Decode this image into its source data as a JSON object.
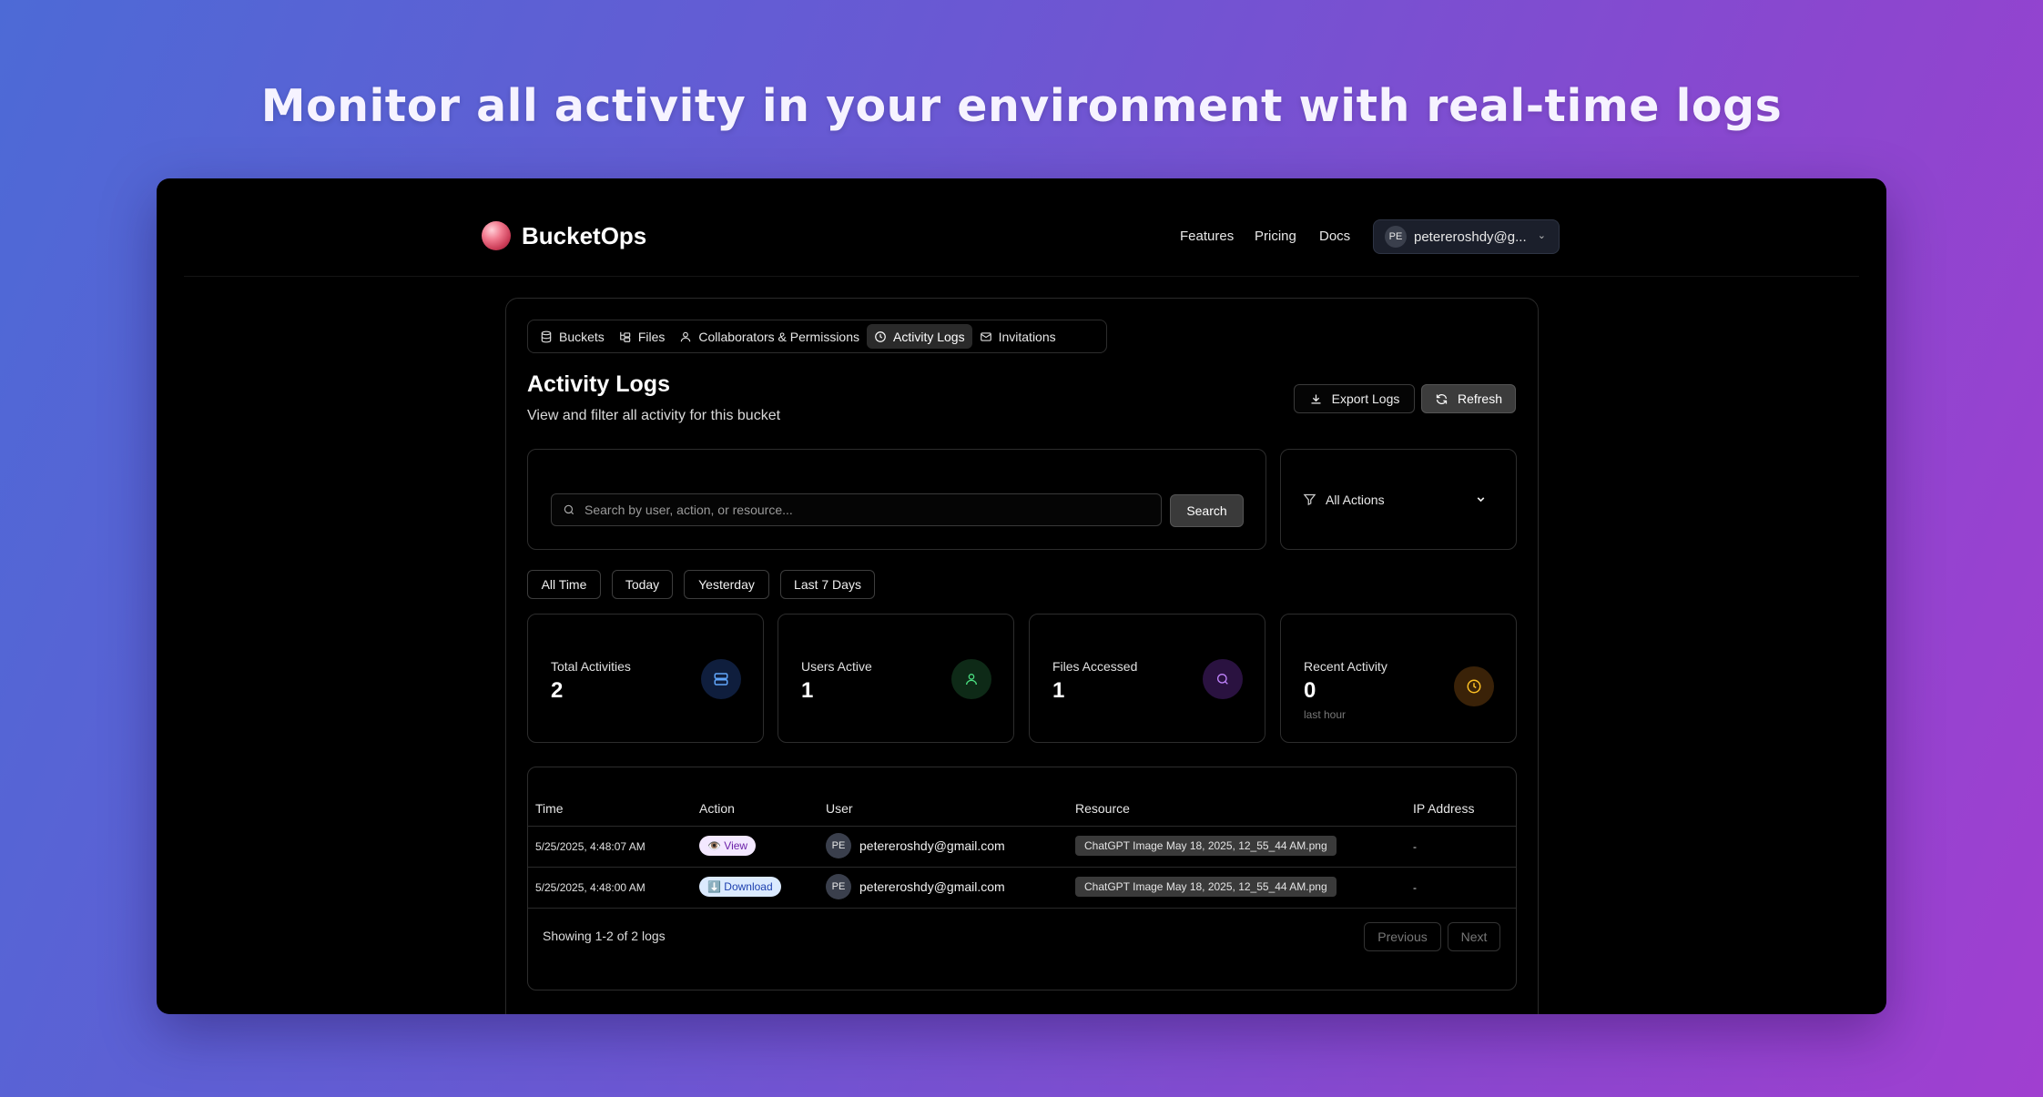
{
  "headline": "Monitor all activity in your environment with real-time logs",
  "nav": {
    "brand": "BucketOps",
    "links": [
      "Features",
      "Pricing",
      "Docs"
    ],
    "user_initials": "PE",
    "user_email": "petereroshdy@g..."
  },
  "tabs": [
    {
      "label": "Buckets",
      "icon": "database-icon"
    },
    {
      "label": "Files",
      "icon": "folder-tree-icon"
    },
    {
      "label": "Collaborators & Permissions",
      "icon": "user-icon"
    },
    {
      "label": "Activity Logs",
      "icon": "clock-icon",
      "active": true
    },
    {
      "label": "Invitations",
      "icon": "mail-icon"
    }
  ],
  "page": {
    "title": "Activity Logs",
    "subtitle": "View and filter all activity for this bucket",
    "export_label": "Export Logs",
    "refresh_label": "Refresh"
  },
  "search": {
    "placeholder": "Search by user, action, or resource...",
    "button": "Search"
  },
  "filter": {
    "selected": "All Actions"
  },
  "date_filters": [
    "All Time",
    "Today",
    "Yesterday",
    "Last 7 Days"
  ],
  "stats": [
    {
      "label": "Total Activities",
      "value": "2",
      "icon": "server-icon",
      "color": "#3b82f6"
    },
    {
      "label": "Users Active",
      "value": "1",
      "icon": "user-icon",
      "color": "#22c55e"
    },
    {
      "label": "Files Accessed",
      "value": "1",
      "icon": "search-icon",
      "color": "#a855f7"
    },
    {
      "label": "Recent Activity",
      "value": "0",
      "sub": "last hour",
      "icon": "clock-icon",
      "color": "#f59e0b"
    }
  ],
  "table": {
    "headers": [
      "Time",
      "Action",
      "User",
      "Resource",
      "IP Address"
    ],
    "rows": [
      {
        "time": "5/25/2025, 4:48:07 AM",
        "action": "👁️ View",
        "action_type": "view",
        "initials": "PE",
        "user": "petereroshdy@gmail.com",
        "resource": "ChatGPT Image May 18, 2025, 12_55_44 AM.png",
        "ip": "-"
      },
      {
        "time": "5/25/2025, 4:48:00 AM",
        "action": "⬇️ Download",
        "action_type": "download",
        "initials": "PE",
        "user": "petereroshdy@gmail.com",
        "resource": "ChatGPT Image May 18, 2025, 12_55_44 AM.png",
        "ip": "-"
      }
    ],
    "showing": "Showing 1-2 of 2 logs",
    "prev": "Previous",
    "next": "Next"
  }
}
